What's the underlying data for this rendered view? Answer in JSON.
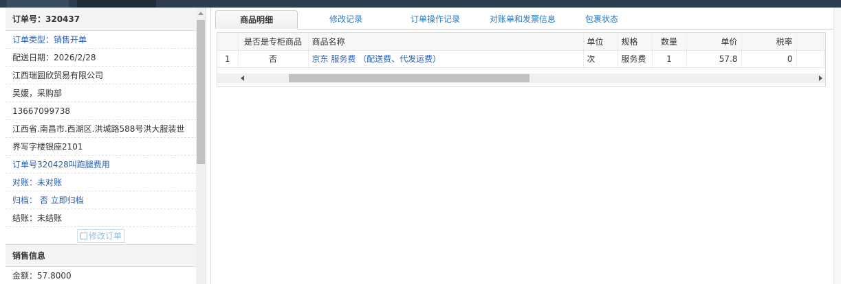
{
  "order_panel": {
    "header": "订单号：320437",
    "rows": [
      {
        "text": "订单类型：销售开单",
        "style": "blue"
      },
      {
        "text": "配送日期：2026/2/28",
        "style": "normal"
      },
      {
        "text": "江西瑞圆欣贸易有限公司",
        "style": "normal"
      },
      {
        "text": "吴媛，采购部",
        "style": "normal"
      },
      {
        "text": "13667099738",
        "style": "normal"
      },
      {
        "text": "江西省.南昌市.西湖区.洪城路588号洪大服装世",
        "style": "normal"
      },
      {
        "text": "界写字楼银座2101",
        "style": "normal"
      },
      {
        "text": "订单号320428叫跑腿费用",
        "style": "blue"
      },
      {
        "text": "对账：未对账",
        "style": "blue"
      },
      {
        "text": "归档： 否 立即归档",
        "style": "blue"
      },
      {
        "text": "结账：未结账",
        "style": "normal"
      }
    ],
    "edit_button": "修改订单",
    "sales_section": "销售信息",
    "amount": "金额：57.8000"
  },
  "tabs": [
    "商品明细",
    "修改记录",
    "订单操作记录",
    "对账单和发票信息",
    "包裹状态"
  ],
  "grid": {
    "columns": [
      "",
      "是否是专柜商品",
      "商品名称",
      "单位",
      "规格",
      "数量",
      "单价",
      "税率"
    ],
    "rows": [
      [
        "1",
        "否",
        "京东 服务费 （配送费、代发运费）",
        "次",
        "服务费",
        "1",
        "57.8",
        "0"
      ]
    ]
  },
  "icons": {
    "edit": "pencil-icon",
    "scroll_left": "arrow-left-icon",
    "scroll_right": "arrow-right-icon",
    "scroll_up": "arrow-up-icon"
  },
  "colors": {
    "link": "#2a5db0",
    "tab": "#2a78c2",
    "topbar": "#2d3e50"
  }
}
